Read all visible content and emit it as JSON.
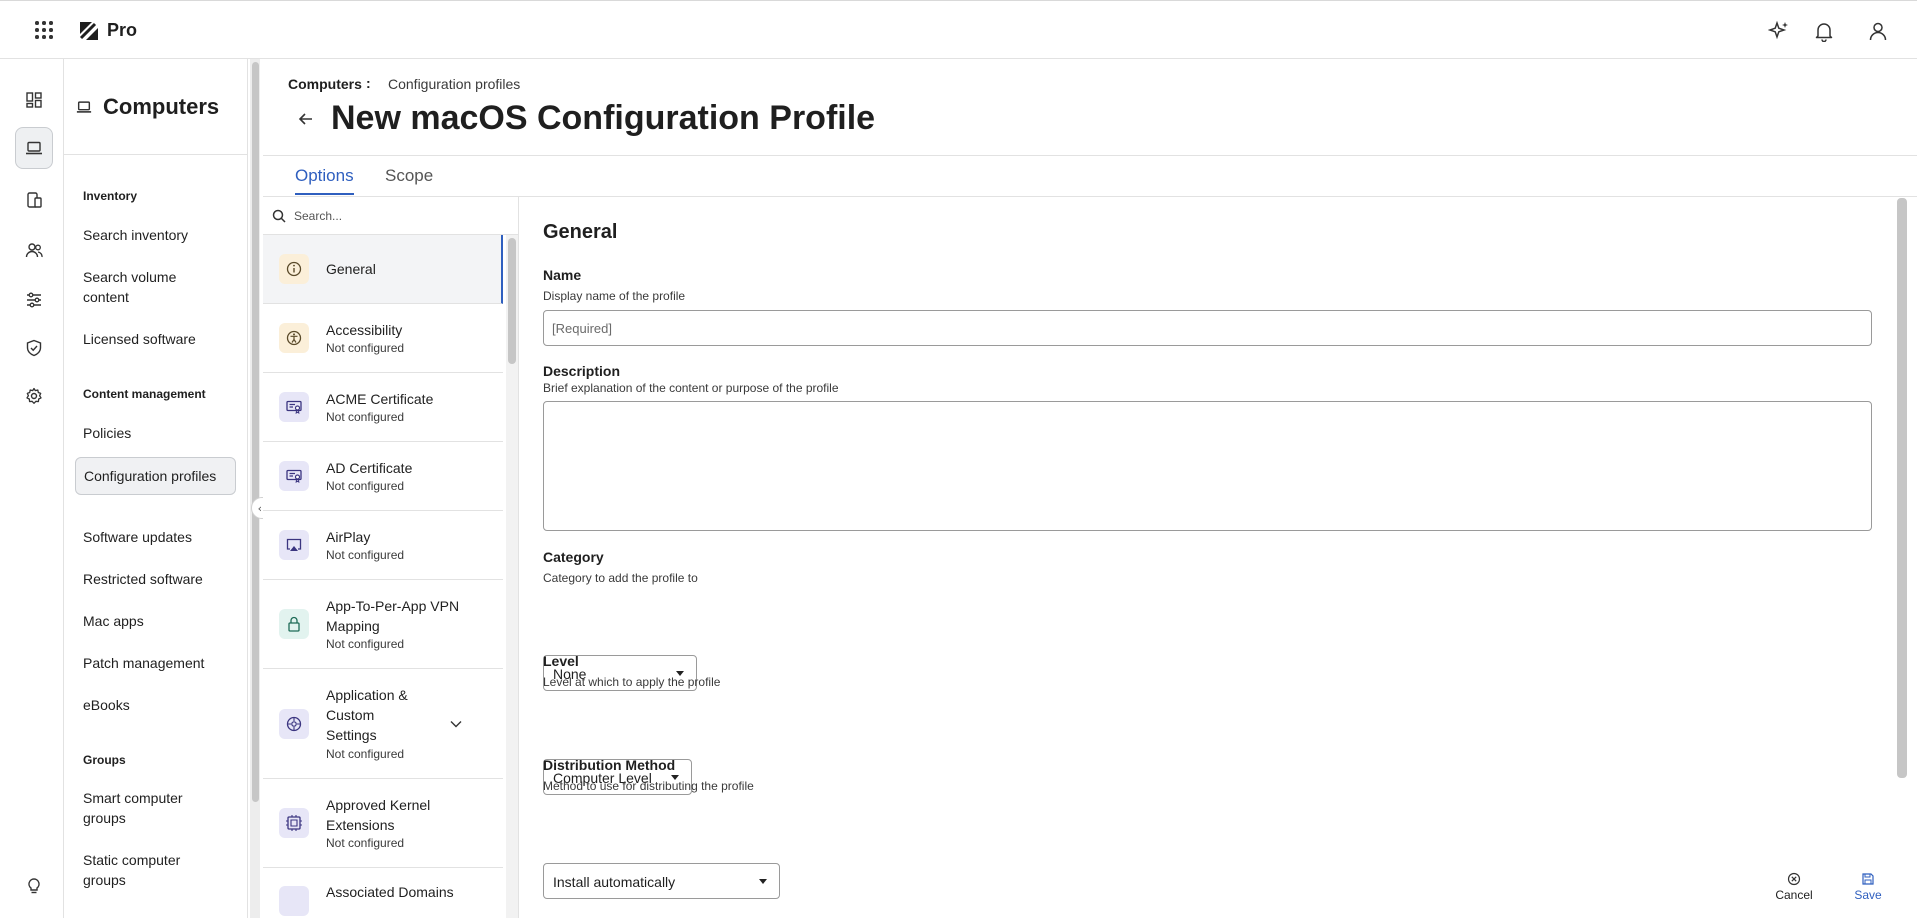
{
  "app": {
    "brand": "Pro"
  },
  "sidebar": {
    "title": "Computers",
    "sections": [
      {
        "heading": "Inventory",
        "items": [
          "Search inventory",
          "Search volume content",
          "Licensed software"
        ]
      },
      {
        "heading": "Content management",
        "items": [
          "Policies",
          "Configuration profiles",
          "Software updates",
          "Restricted software",
          "Mac apps",
          "Patch management",
          "eBooks"
        ]
      },
      {
        "heading": "Groups",
        "items": [
          "Smart computer groups",
          "Static computer groups"
        ]
      }
    ],
    "active_item": "Configuration profiles"
  },
  "breadcrumb": {
    "root": "Computers",
    "separator": ":",
    "current": "Configuration profiles"
  },
  "page": {
    "title": "New macOS Configuration Profile"
  },
  "tabs": [
    {
      "label": "Options",
      "active": true
    },
    {
      "label": "Scope",
      "active": false
    }
  ],
  "payload_list": {
    "search_placeholder": "Search...",
    "items": [
      {
        "name": "General",
        "status": "",
        "icon": "info-icon",
        "active": true
      },
      {
        "name": "Accessibility",
        "status": "Not configured",
        "icon": "accessibility-icon"
      },
      {
        "name": "ACME Certificate",
        "status": "Not configured",
        "icon": "certificate-icon"
      },
      {
        "name": "AD Certificate",
        "status": "Not configured",
        "icon": "certificate-icon"
      },
      {
        "name": "AirPlay",
        "status": "Not configured",
        "icon": "airplay-icon"
      },
      {
        "name": "App-To-Per-App VPN Mapping",
        "status": "Not configured",
        "icon": "lock-icon"
      },
      {
        "name": "Application & Custom Settings",
        "status": "Not configured",
        "icon": "settings-gear-icon",
        "expandable": true
      },
      {
        "name": "Approved Kernel Extensions",
        "status": "Not configured",
        "icon": "kernel-extension-icon"
      },
      {
        "name": "Associated Domains",
        "status": "",
        "icon": "domains-icon"
      }
    ]
  },
  "form": {
    "section_title": "General",
    "name": {
      "label": "Name",
      "help": "Display name of the profile",
      "placeholder": "[Required]",
      "value": ""
    },
    "description": {
      "label": "Description",
      "help": "Brief explanation of the content or purpose of the profile",
      "value": ""
    },
    "category": {
      "label": "Category",
      "help": "Category to add the profile to",
      "value": "None"
    },
    "level": {
      "label": "Level",
      "help": "Level at which to apply the profile",
      "value": "Computer Level"
    },
    "distribution": {
      "label": "Distribution Method",
      "help": "Method to use for distributing the profile",
      "value": "Install automatically"
    }
  },
  "footer": {
    "cancel_label": "Cancel",
    "save_label": "Save"
  },
  "colors": {
    "accent": "#2f5fbf",
    "general_icon_bg": "#fbefd9",
    "accessibility_icon_bg": "#fbefd9",
    "purple_icon_bg": "#e7e6f7",
    "green_icon_bg": "#e2f3ef"
  }
}
